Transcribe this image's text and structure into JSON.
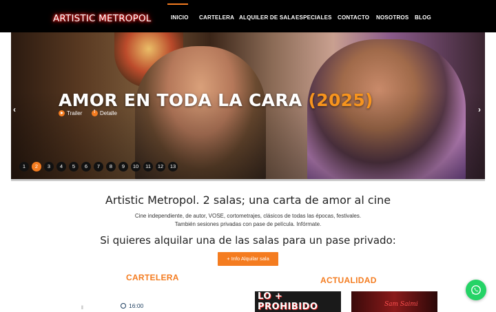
{
  "brand": {
    "logo": "ARTISTIC METROPOL"
  },
  "nav": {
    "items": [
      {
        "label": "INICIO",
        "active": true
      },
      {
        "label": "CARTELERA"
      },
      {
        "label": "ALQUILER DE SALA"
      },
      {
        "label": "ESPECIALES"
      },
      {
        "label": "CONTACTO"
      },
      {
        "label": "NOSOTROS"
      },
      {
        "label": "BLOG"
      }
    ]
  },
  "slider": {
    "title": "AMOR EN TODA LA CARA",
    "year": "(2025)",
    "trailer_label": "Trailer",
    "detail_label": "Detalle",
    "prev_icon": "chevron-left-icon",
    "next_icon": "chevron-right-icon",
    "pages": [
      "1",
      "2",
      "3",
      "4",
      "5",
      "6",
      "7",
      "8",
      "9",
      "10",
      "11",
      "12",
      "13"
    ],
    "active_page": "2"
  },
  "intro": {
    "title": "Artistic Metropol. 2 salas; una carta de amor al cine",
    "line1": "Cine independiente, de autor, VOSE, cortometrajes, clásicos de todas las épocas, festivales.",
    "line2": "También sesiones privadas con pase de película. Infórmate.",
    "private_title": "Si quieres alquilar una de las salas para un pase privado:",
    "button_label": "+ Info Alquilar sala"
  },
  "cartelera": {
    "heading": "CARTELERA",
    "time": "16:00"
  },
  "actualidad": {
    "heading": "ACTUALIDAD",
    "poster1_text": "LO + PROHIBIDO",
    "poster2_text": "Sam Saimi"
  },
  "colors": {
    "accent": "#f47c20",
    "nav_bg": "#000000",
    "whatsapp": "#25d366"
  }
}
